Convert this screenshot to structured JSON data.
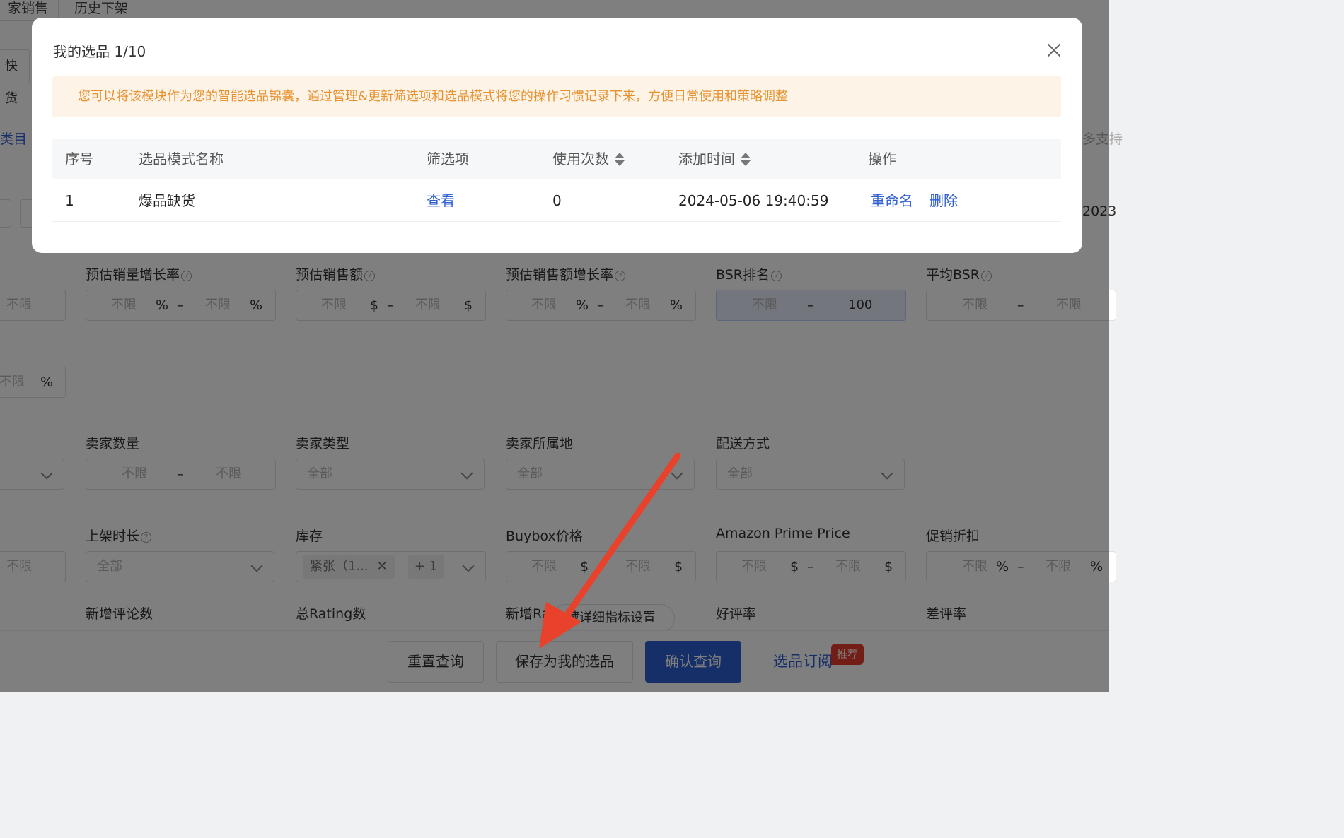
{
  "background": {
    "tabs": [
      "家销售",
      "历史下架"
    ],
    "side_labels": [
      "快货",
      "类目"
    ],
    "right_edge_text": [
      "多支持",
      "2023"
    ],
    "fields_row1": [
      {
        "label": "预估销量增长率",
        "from": "不限",
        "to": "不限",
        "unit": "%"
      },
      {
        "label": "预估销售额",
        "from": "不限",
        "to": "不限",
        "unit": "$"
      },
      {
        "label": "预估销售额增长率",
        "from": "不限",
        "to": "不限",
        "unit": "%"
      },
      {
        "label": "BSR排名",
        "from": "不限",
        "to": "100"
      },
      {
        "label": "平均BSR",
        "from": "不限",
        "to": "不限"
      }
    ],
    "left_partial": {
      "row1": "不限",
      "row2": "不限",
      "row2_unit": "%",
      "row4": "不限"
    },
    "fields_row3": [
      {
        "label": "卖家数量",
        "from": "不限",
        "to": "不限"
      },
      {
        "label": "卖家类型",
        "value": "全部"
      },
      {
        "label": "卖家所属地",
        "value": "全部"
      },
      {
        "label": "配送方式",
        "value": "全部"
      }
    ],
    "fields_row4": [
      {
        "label": "上架时长",
        "value": "全部"
      },
      {
        "label": "库存",
        "chip": "紧张（1...",
        "chip_more": "+ 1"
      },
      {
        "label": "Buybox价格",
        "from": "不限",
        "to": "不限",
        "unit": "$"
      },
      {
        "label": "Amazon Prime Price",
        "from": "不限",
        "to": "不限",
        "unit": "$"
      },
      {
        "label": "促销折扣",
        "from": "不限",
        "to": "不限",
        "unit": "%"
      }
    ],
    "fields_row5": [
      "新增评论数",
      "总Rating数",
      "新增Ra",
      "好评率",
      "差评率"
    ],
    "collapse_label": "藏详细指标设置",
    "buttons": {
      "reset": "重置查询",
      "save": "保存为我的选品",
      "confirm": "确认查询",
      "subscribe": "选品订阅",
      "subscribe_badge": "推荐"
    },
    "accent_color": "#2f5fd0"
  },
  "modal": {
    "title": "我的选品 1/10",
    "notice": "您可以将该模块作为您的智能选品锦囊，通过管理&更新筛选项和选品模式将您的操作习惯记录下来，方便日常使用和策略调整",
    "columns": [
      "序号",
      "选品模式名称",
      "筛选项",
      "使用次数",
      "添加时间",
      "操作"
    ],
    "rows": [
      {
        "index": "1",
        "name": "爆品缺货",
        "filters_link": "查看",
        "uses": "0",
        "added": "2024-05-06 19:40:59",
        "rename": "重命名",
        "delete": "删除"
      }
    ]
  },
  "annotation": {
    "arrow_color": "#e8412c"
  }
}
